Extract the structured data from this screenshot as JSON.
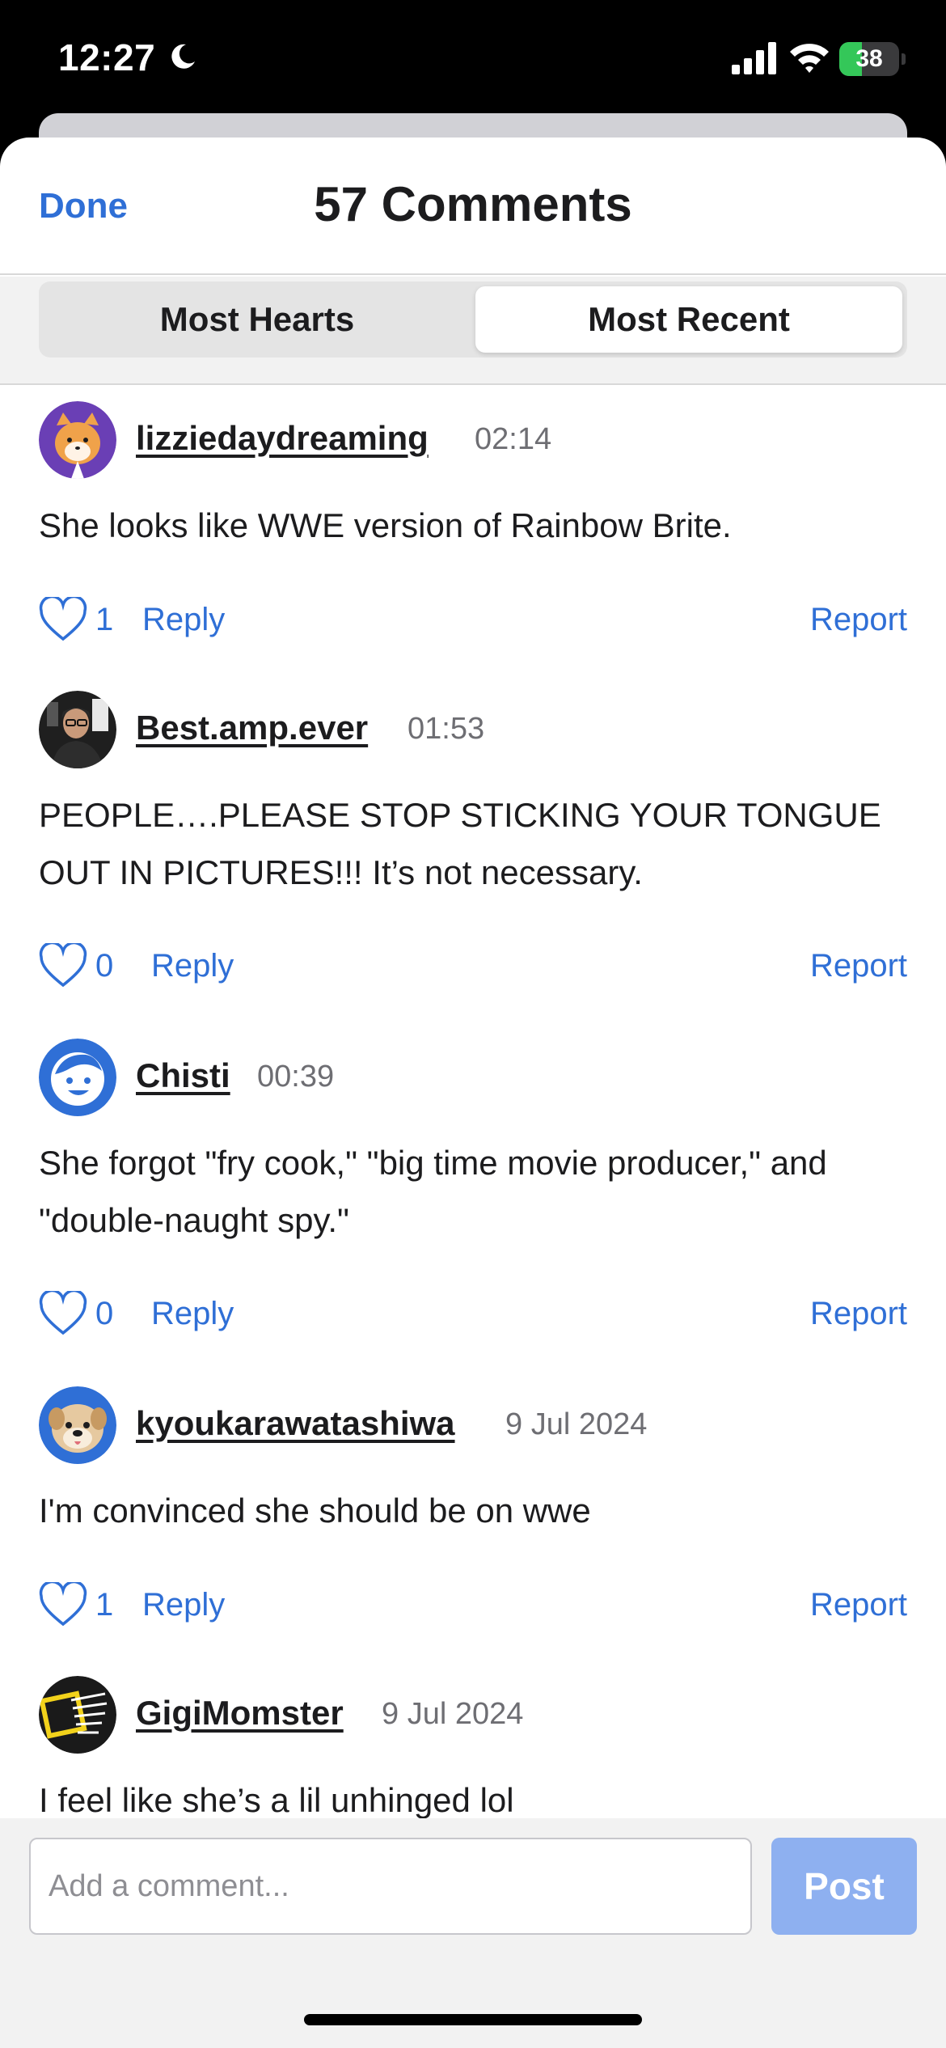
{
  "status_bar": {
    "time": "12:27",
    "battery_level": "38",
    "battery_fraction": 0.38,
    "colors": {
      "battery": "#34c759"
    }
  },
  "header": {
    "done_label": "Done",
    "title": "57 Comments"
  },
  "sort": {
    "options": [
      "Most Hearts",
      "Most Recent"
    ],
    "selected": "Most Recent"
  },
  "comments": [
    {
      "username": "lizziedaydreaming",
      "time": "02:14",
      "text": "She looks like WWE version of Rainbow Brite.",
      "hearts": "1",
      "avatar": "cat-avatar-icon"
    },
    {
      "username": "Best.amp.ever",
      "time": "01:53",
      "text": "PEOPLE….PLEASE STOP STICKING YOUR TONGUE OUT IN PICTURES!!! It’s not necessary.",
      "hearts": "0",
      "avatar": "photo-avatar"
    },
    {
      "username": "Chisti",
      "time": "00:39",
      "text": "She forgot \"fry cook,\" \"big time movie producer,\" and \"double-naught spy.\"",
      "hearts": "0",
      "avatar": "default-face-icon"
    },
    {
      "username": "kyoukarawatashiwa",
      "time": "9 Jul 2024",
      "text": "I'm convinced she should be on wwe",
      "hearts": "1",
      "avatar": "dog-avatar-icon"
    },
    {
      "username": "GigiMomster",
      "time": "9 Jul 2024",
      "text": "I feel like she’s a lil unhinged lol",
      "hearts": "",
      "avatar": "badge-avatar"
    }
  ],
  "actions": {
    "reply_label": "Reply",
    "report_label": "Report"
  },
  "composer": {
    "placeholder": "Add a comment...",
    "post_label": "Post"
  },
  "colors": {
    "accent": "#2f6fd6",
    "post_disabled": "#8eb0f0"
  }
}
